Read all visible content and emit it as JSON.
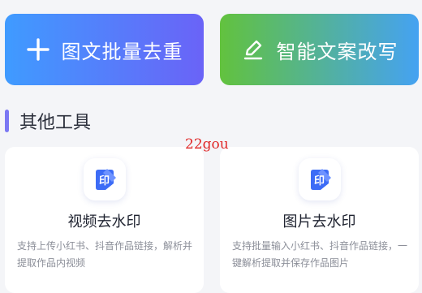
{
  "actions": {
    "batch_dedup": {
      "label": "图文批量去重",
      "icon": "plus-icon"
    },
    "smart_rewrite": {
      "label": "智能文案改写",
      "icon": "pen-edit-icon"
    }
  },
  "section": {
    "title": "其他工具"
  },
  "watermark_text": "22gou",
  "tools": [
    {
      "title": "视频去水印",
      "description": "支持上传小红书、抖音作品链接，解析并提取作品内视频",
      "icon": "stamp-icon"
    },
    {
      "title": "图片去水印",
      "description": "支持批量输入小红书、抖音作品链接，一键解析提取并保存作品图片",
      "icon": "stamp-icon"
    }
  ],
  "colors": {
    "batch_gradient": [
      "#3f9bff",
      "#6a63f7"
    ],
    "rewrite_gradient": [
      "#62c23e",
      "#45a2f2"
    ],
    "section_accent": "#7b78f3",
    "icon_blue": "#3d6cf6"
  }
}
